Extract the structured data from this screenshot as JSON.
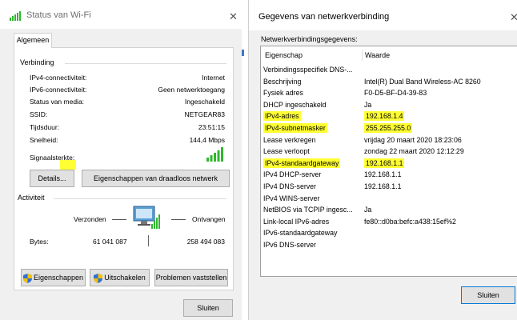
{
  "wifi_window": {
    "title": "Status van Wi-Fi",
    "tab": "Algemeen",
    "connection": {
      "group_label": "Verbinding",
      "rows": [
        {
          "label": "IPv4-connectiviteit:",
          "value": "Internet"
        },
        {
          "label": "IPv6-connectiviteit:",
          "value": "Geen netwerktoegang"
        },
        {
          "label": "Status van media:",
          "value": "Ingeschakeld"
        },
        {
          "label": "SSID:",
          "value": "NETGEAR83"
        },
        {
          "label": "Tijdsduur:",
          "value": "23:51:15"
        },
        {
          "label": "Snelheid:",
          "value": "144,4 Mbps"
        }
      ],
      "signal_label": "Signaalsterkte:",
      "details_button": "Details...",
      "wireless_props_button": "Eigenschappen van draadloos netwerk"
    },
    "activity": {
      "group_label": "Activiteit",
      "sent_label": "Verzonden",
      "received_label": "Ontvangen",
      "bytes_label": "Bytes:",
      "bytes_sent": "61 041 087",
      "bytes_received": "258 494 083"
    },
    "buttons": {
      "properties": "Eigenschappen",
      "disable": "Uitschakelen",
      "diagnose": "Problemen vaststellen",
      "close": "Sluiten"
    }
  },
  "net_window": {
    "title": "Gegevens van netwerkverbinding",
    "section_label": "Netwerkverbindingsgegevens:",
    "columns": [
      "Eigenschap",
      "Waarde"
    ],
    "rows": [
      {
        "prop": "Verbindingsspecifiek DNS-...",
        "value": "",
        "highlight": false
      },
      {
        "prop": "Beschrijving",
        "value": "Intel(R) Dual Band Wireless-AC 8260",
        "highlight": false
      },
      {
        "prop": "Fysiek adres",
        "value": "F0-D5-BF-D4-39-83",
        "highlight": false
      },
      {
        "prop": "DHCP ingeschakeld",
        "value": "Ja",
        "highlight": false
      },
      {
        "prop": "IPv4-adres",
        "value": "192.168.1.4",
        "highlight": true
      },
      {
        "prop": "IPv4-subnetmasker",
        "value": "255.255.255.0",
        "highlight": true
      },
      {
        "prop": "Lease verkregen",
        "value": "vrijdag 20 maart 2020 18:23:06",
        "highlight": false
      },
      {
        "prop": "Lease verloopt",
        "value": "zondag 22 maart 2020 12:12:29",
        "highlight": false
      },
      {
        "prop": "IPv4-standaardgateway",
        "value": "192.168.1.1",
        "highlight": true
      },
      {
        "prop": "IPv4 DHCP-server",
        "value": "192.168.1.1",
        "highlight": false
      },
      {
        "prop": "IPv4 DNS-server",
        "value": "192.168.1.1",
        "highlight": false
      },
      {
        "prop": "IPv4 WINS-server",
        "value": "",
        "highlight": false
      },
      {
        "prop": "NetBIOS via TCPIP ingesc...",
        "value": "Ja",
        "highlight": false
      },
      {
        "prop": "Link-local IPv6-adres",
        "value": "fe80::d0ba:befc:a438:15ef%2",
        "highlight": false
      },
      {
        "prop": "IPv6-standaardgateway",
        "value": "",
        "highlight": false
      },
      {
        "prop": "IPv6 DNS-server",
        "value": "",
        "highlight": false
      }
    ],
    "close_button": "Sluiten"
  },
  "colors": {
    "highlight": "#ffff33",
    "signal_green": "#2eb82e",
    "accent_border": "#0078d7"
  },
  "icons": {
    "title_icon": "wifi-signal-icon",
    "close": "close-icon",
    "shield": "uac-shield-icon",
    "network": "network-computer-icon"
  }
}
